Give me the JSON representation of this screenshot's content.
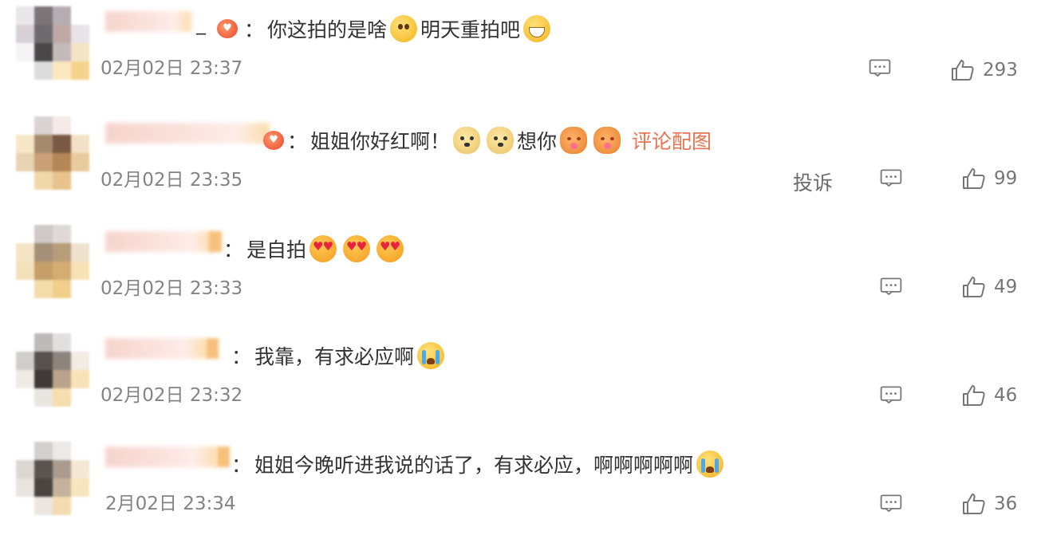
{
  "comments": [
    {
      "text": "你这拍的是啥",
      "text2": "明天重拍吧",
      "timestamp": "02月02日 23:37",
      "likes": "293",
      "emojis": [
        "sad-emoji",
        "grin-emoji"
      ]
    },
    {
      "text": "姐姐你好红啊！",
      "text2": "想你",
      "image_link": "评论配图",
      "timestamp": "02月02日 23:35",
      "report": "投诉",
      "likes": "99"
    },
    {
      "text": "是自拍",
      "timestamp": "02月02日 23:33",
      "likes": "49"
    },
    {
      "text": "我靠，有求必应啊",
      "timestamp": "02月02日 23:32",
      "likes": "46"
    },
    {
      "text": "姐姐今晚听进我说的话了，有求必应，啊啊啊啊啊",
      "timestamp": "2月02日 23:34",
      "likes": "36"
    }
  ],
  "separator": "：",
  "username_suffix": "_",
  "colors": {
    "text": "#333333",
    "meta": "#838383",
    "link": "#eb7350"
  }
}
